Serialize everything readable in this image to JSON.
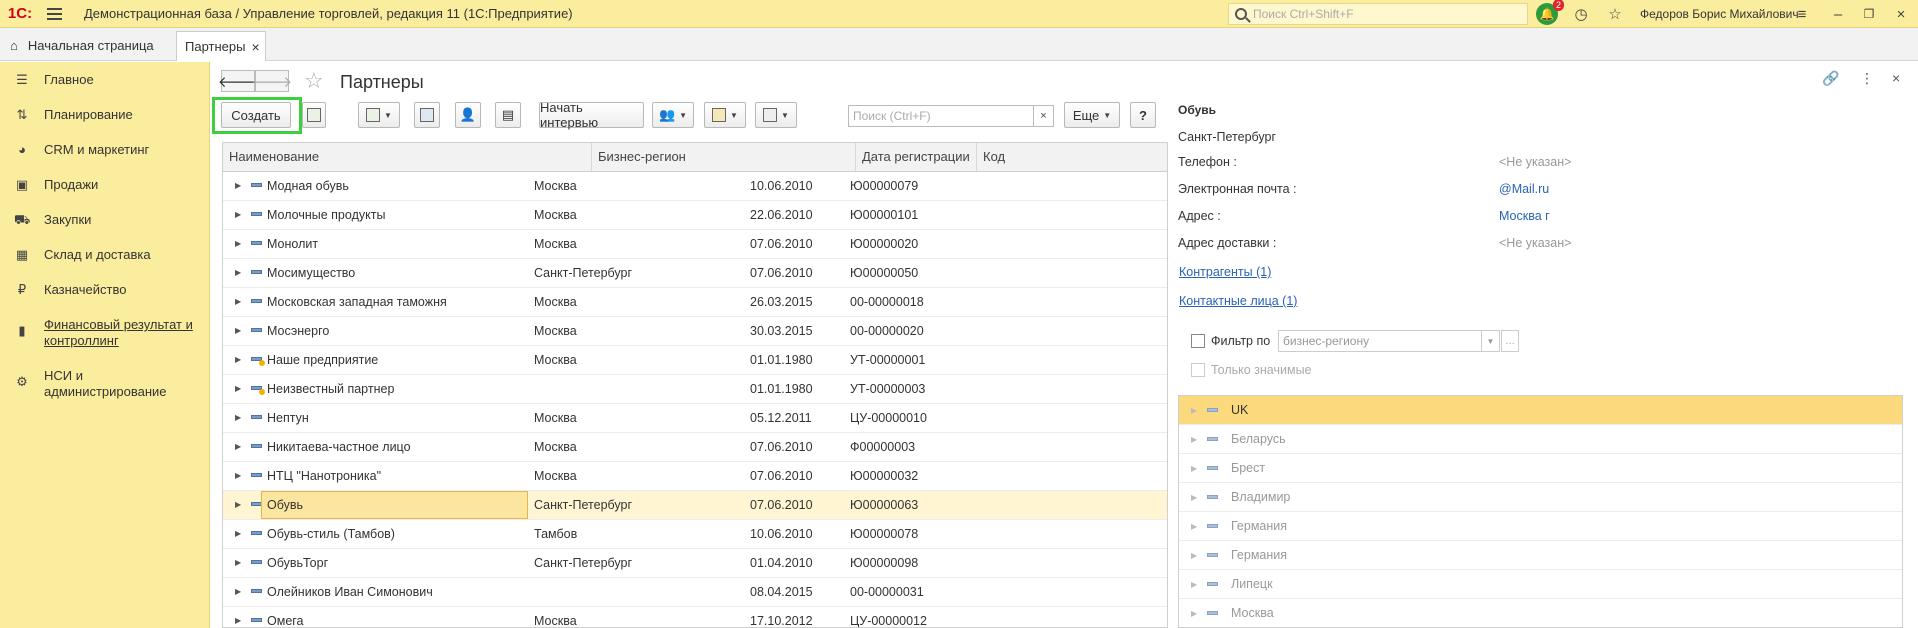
{
  "titlebar": {
    "logo": "1С:",
    "title": "Демонстрационная база / Управление торговлей, редакция 11  (1С:Предприятие)",
    "search_placeholder": "Поиск Ctrl+Shift+F",
    "notification_count": "2",
    "user": "Федоров Борис Михайлович"
  },
  "tabs": {
    "home": "Начальная страница",
    "active": "Партнеры"
  },
  "sidebar": {
    "items": [
      {
        "label": "Главное",
        "icon": "menu-icon"
      },
      {
        "label": "Планирование",
        "icon": "planning-icon"
      },
      {
        "label": "CRM и маркетинг",
        "icon": "crm-icon"
      },
      {
        "label": "Продажи",
        "icon": "sales-bag-icon"
      },
      {
        "label": "Закупки",
        "icon": "cart-icon"
      },
      {
        "label": "Склад и доставка",
        "icon": "warehouse-icon"
      },
      {
        "label": "Казначейство",
        "icon": "treasury-icon"
      },
      {
        "label": "Финансовый результат и контроллинг",
        "icon": "chart-icon"
      },
      {
        "label": "НСИ и администрирование",
        "icon": "gear-icon"
      }
    ]
  },
  "page": {
    "title": "Партнеры"
  },
  "toolbar": {
    "create": "Создать",
    "start_interview": "Начать интервью",
    "search_placeholder": "Поиск (Ctrl+F)",
    "more": "Еще",
    "help": "?"
  },
  "table": {
    "columns": [
      "Наименование",
      "Бизнес-регион",
      "Дата регистрации",
      "Код"
    ],
    "rows": [
      {
        "name": "Модная обувь",
        "region": "Москва",
        "date": "10.06.2010",
        "code": "Ю00000079"
      },
      {
        "name": "Молочные продукты",
        "region": "Москва",
        "date": "22.06.2010",
        "code": "Ю00000101"
      },
      {
        "name": "Монолит",
        "region": "Москва",
        "date": "07.06.2010",
        "code": "Ю00000020"
      },
      {
        "name": "Мосимущество",
        "region": "Санкт-Петербург",
        "date": "07.06.2010",
        "code": "Ю00000050"
      },
      {
        "name": "Московская западная таможня",
        "region": "Москва",
        "date": "26.03.2015",
        "code": "00-00000018"
      },
      {
        "name": "Мосэнерго",
        "region": "Москва",
        "date": "30.03.2015",
        "code": "00-00000020"
      },
      {
        "name": "Наше предприятие",
        "region": "Москва",
        "date": "01.01.1980",
        "code": "УТ-00000001"
      },
      {
        "name": "Неизвестный партнер",
        "region": "",
        "date": "01.01.1980",
        "code": "УТ-00000003"
      },
      {
        "name": "Нептун",
        "region": "Москва",
        "date": "05.12.2011",
        "code": "ЦУ-00000010"
      },
      {
        "name": "Никитаева-частное лицо",
        "region": "Москва",
        "date": "07.06.2010",
        "code": "Ф00000003"
      },
      {
        "name": "НТЦ \"Нанотроника\"",
        "region": "Москва",
        "date": "07.06.2010",
        "code": "Ю00000032"
      },
      {
        "name": "Обувь",
        "region": "Санкт-Петербург",
        "date": "07.06.2010",
        "code": "Ю00000063"
      },
      {
        "name": "Обувь-стиль (Тамбов)",
        "region": "Тамбов",
        "date": "10.06.2010",
        "code": "Ю00000078"
      },
      {
        "name": "ОбувьТорг",
        "region": "Санкт-Петербург",
        "date": "01.04.2010",
        "code": "Ю00000098"
      },
      {
        "name": "Олейников Иван Симонович",
        "region": "",
        "date": "08.04.2015",
        "code": "00-00000031"
      },
      {
        "name": "Омега",
        "region": "Москва",
        "date": "17.10.2012",
        "code": "ЦУ-00000012"
      }
    ]
  },
  "details": {
    "title": "Обувь",
    "city": "Санкт-Петербург",
    "phone_label": "Телефон :",
    "phone_value": "<Не указан>",
    "email_label": "Электронная почта :",
    "email_value": "@Mail.ru",
    "address_label": "Адрес :",
    "address_value": "Москва г",
    "delivery_label": "Адрес доставки :",
    "delivery_value": "<Не указан>",
    "contractors_link": "Контрагенты (1)",
    "contacts_link": "Контактные лица (1)",
    "filter_label": "Фильтр по",
    "filter_value": "бизнес-региону",
    "only_significant": "Только значимые",
    "regions": [
      "UK",
      "Беларусь",
      "Брест",
      "Владимир",
      "Германия",
      "Германия",
      "Липецк",
      "Москва"
    ]
  }
}
